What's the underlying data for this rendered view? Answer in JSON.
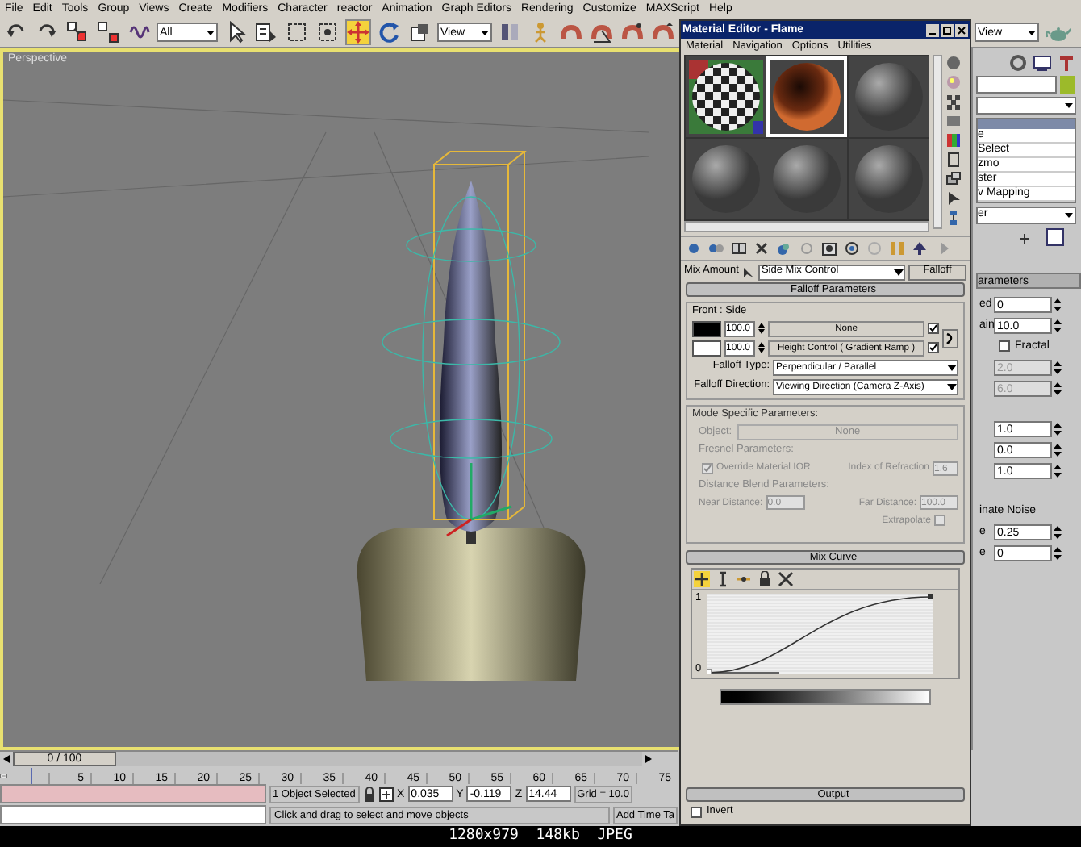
{
  "menu_bar": [
    "File",
    "Edit",
    "Tools",
    "Group",
    "Views",
    "Create",
    "Modifiers",
    "Character",
    "reactor",
    "Animation",
    "Graph Editors",
    "Rendering",
    "Customize",
    "MAXScript",
    "Help"
  ],
  "toolbar": {
    "tools": [
      {
        "kind": "undo",
        "selected": false
      },
      {
        "kind": "redo",
        "selected": false
      },
      {
        "kind": "link",
        "selected": false
      },
      {
        "kind": "unlink",
        "selected": false
      },
      {
        "kind": "bind",
        "selected": false
      },
      {
        "kind": "filter",
        "value": "All"
      },
      {
        "kind": "select",
        "selected": false
      },
      {
        "kind": "select-by-name",
        "selected": false
      },
      {
        "kind": "region",
        "selected": false
      },
      {
        "kind": "window",
        "selected": false
      },
      {
        "kind": "move",
        "selected": true
      },
      {
        "kind": "rotate",
        "selected": false
      },
      {
        "kind": "scale",
        "selected": false
      },
      {
        "kind": "coord",
        "value": "View"
      },
      {
        "kind": "pivot",
        "selected": false
      },
      {
        "kind": "manipulate",
        "selected": false
      },
      {
        "kind": "snap",
        "selected": false
      },
      {
        "kind": "angle-snap",
        "selected": false
      },
      {
        "kind": "percent-snap",
        "selected": false
      },
      {
        "kind": "spinner-snap",
        "selected": false
      }
    ]
  },
  "viewport": {
    "label": "Perspective",
    "active": true
  },
  "material_editor": {
    "title": "Material Editor - Flame",
    "menus": [
      "Material",
      "Navigation",
      "Options",
      "Utilities"
    ],
    "slots": [
      {
        "kind": "checker",
        "selected": false
      },
      {
        "kind": "copper",
        "selected": true
      },
      {
        "kind": "gray",
        "selected": false
      },
      {
        "kind": "gray",
        "selected": false
      },
      {
        "kind": "gray",
        "selected": false
      },
      {
        "kind": "gray",
        "selected": false
      }
    ],
    "side_tools": [
      {
        "kind": "sphere"
      },
      {
        "kind": "backlight"
      },
      {
        "kind": "checker"
      },
      {
        "kind": "square"
      },
      {
        "kind": "color"
      },
      {
        "kind": "video"
      },
      {
        "kind": "box"
      },
      {
        "kind": "cursor"
      },
      {
        "kind": "tree"
      }
    ],
    "bottom_tools": [
      {
        "kind": "get"
      },
      {
        "kind": "put"
      },
      {
        "kind": "assign"
      },
      {
        "kind": "reset"
      },
      {
        "kind": "copy"
      },
      {
        "kind": "unique"
      },
      {
        "kind": "library"
      },
      {
        "kind": "id"
      },
      {
        "kind": "show"
      },
      {
        "kind": "map"
      },
      {
        "kind": "go-parent"
      },
      {
        "kind": "go-sibling"
      }
    ],
    "mix_amount_label": "Mix Amount",
    "map_slot": "Side Mix Control",
    "map_type": "Falloff",
    "falloff": {
      "title": "Falloff Parameters",
      "group": "Front : Side",
      "rows": [
        {
          "color": "#000000",
          "amount": "100.0",
          "map": "None",
          "enabled": true
        },
        {
          "color": "#ffffff",
          "amount": "100.0",
          "map": "Height Control  ( Gradient Ramp )",
          "enabled": true
        }
      ],
      "type_label": "Falloff Type:",
      "type": "Perpendicular / Parallel",
      "direction_label": "Falloff Direction:",
      "direction": "Viewing Direction (Camera Z-Axis)"
    },
    "mode_specific": {
      "title": "Mode Specific Parameters:",
      "object_label": "Object:",
      "object": "None",
      "fresnel_title": "Fresnel Parameters:",
      "override_ior": {
        "label": "Override Material IOR",
        "checked": true
      },
      "ior_label": "Index of Refraction",
      "ior": "1.6",
      "distance_title": "Distance Blend Parameters:",
      "near_label": "Near Distance:",
      "near": "0.0",
      "far_label": "Far Distance:",
      "far": "100.0",
      "extrapolate": {
        "label": "Extrapolate",
        "checked": false
      }
    },
    "mix_curve": {
      "title": "Mix Curve",
      "tools": [
        {
          "kind": "move",
          "selected": true
        },
        {
          "kind": "scale",
          "selected": false
        },
        {
          "kind": "insert",
          "selected": false
        },
        {
          "kind": "lock",
          "selected": false
        },
        {
          "kind": "delete",
          "selected": false
        }
      ],
      "y_max": "1",
      "y_min": "0"
    },
    "output": {
      "title": "Output",
      "invert": {
        "label": "Invert",
        "checked": false
      }
    }
  },
  "command_panel": {
    "view": "View",
    "stack": [
      "e",
      "Select",
      "zmo",
      "ster",
      "v Mapping"
    ],
    "stack_below": "er",
    "rollout": "arameters",
    "fields": [
      {
        "kind": "spinner",
        "label": "ed",
        "value": "0"
      },
      {
        "kind": "spinner",
        "label": "ain",
        "value": "10.0"
      },
      {
        "kind": "check",
        "label": "Fractal",
        "checked": false
      },
      {
        "kind": "spinner",
        "value": "2.0",
        "disabled": true
      },
      {
        "kind": "spinner",
        "value": "6.0",
        "disabled": true
      },
      {
        "kind": "gap"
      },
      {
        "kind": "spinner",
        "value": "1.0"
      },
      {
        "kind": "spinner",
        "value": "0.0"
      },
      {
        "kind": "spinner",
        "value": "1.0"
      },
      {
        "kind": "gap"
      },
      {
        "kind": "heading",
        "label": "inate Noise"
      },
      {
        "kind": "spinner",
        "label": "e",
        "value": "0.25"
      },
      {
        "kind": "spinner",
        "label": "e",
        "value": "0"
      }
    ]
  },
  "timeline": {
    "slider": "0 / 100",
    "level": 0,
    "frames": [
      "5",
      "10",
      "15",
      "20",
      "25",
      "30",
      "35",
      "40",
      "45",
      "50",
      "55",
      "60",
      "65",
      "70",
      "75"
    ]
  },
  "status_bar": {
    "selection": "1 Object Selected",
    "coords": [
      {
        "axis": "X",
        "value": "0.035"
      },
      {
        "axis": "Y",
        "value": "-0.119"
      },
      {
        "axis": "Z",
        "value": "14.44"
      }
    ],
    "grid": "Grid = 10.0",
    "prompt": "Click and drag to select and move objects",
    "time_tag": "Add Time Ta"
  },
  "caption": "1280x979  148kb  JPEG"
}
